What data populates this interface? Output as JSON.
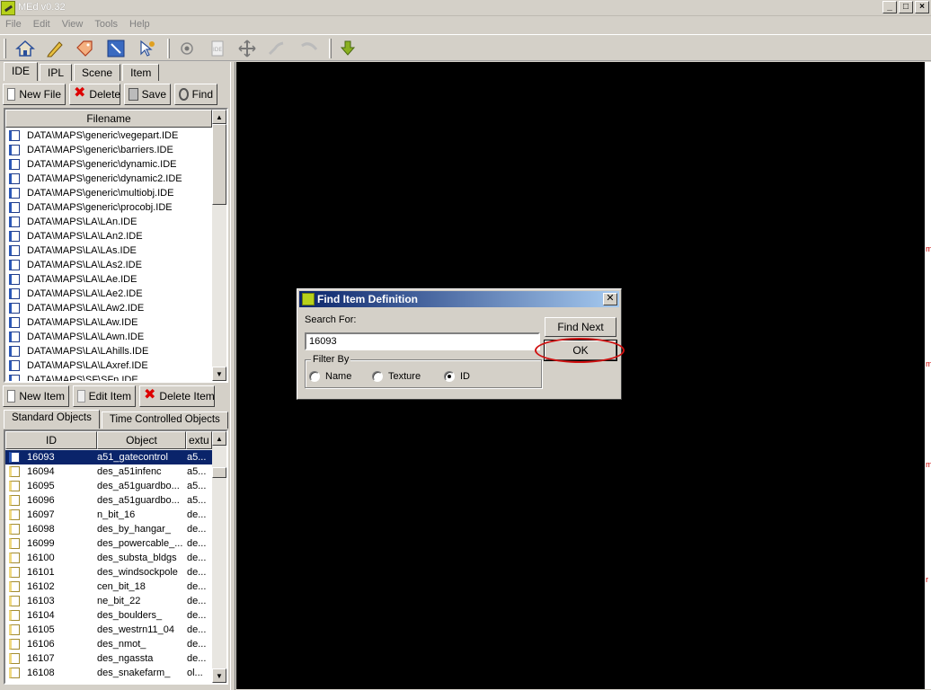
{
  "window": {
    "title": "MEd v0.32"
  },
  "menu": [
    "File",
    "Edit",
    "View",
    "Tools",
    "Help"
  ],
  "toolbar": {
    "icons": [
      "home-icon",
      "pencil-icon",
      "tag-icon",
      "select-icon",
      "pointer-icon",
      "circle-icon",
      "ide-icon",
      "move-icon",
      "rotate-icon",
      "scale-icon",
      "download-arrow-icon"
    ],
    "ide_icon_text": "IDE"
  },
  "tabs": [
    "IDE",
    "IPL",
    "Scene",
    "Item"
  ],
  "file_buttons": {
    "new": "New File",
    "delete": "Delete",
    "save": "Save",
    "find": "Find"
  },
  "file_list": {
    "header": "Filename",
    "rows": [
      "DATA\\MAPS\\generic\\vegepart.IDE",
      "DATA\\MAPS\\generic\\barriers.IDE",
      "DATA\\MAPS\\generic\\dynamic.IDE",
      "DATA\\MAPS\\generic\\dynamic2.IDE",
      "DATA\\MAPS\\generic\\multiobj.IDE",
      "DATA\\MAPS\\generic\\procobj.IDE",
      "DATA\\MAPS\\LA\\LAn.IDE",
      "DATA\\MAPS\\LA\\LAn2.IDE",
      "DATA\\MAPS\\LA\\LAs.IDE",
      "DATA\\MAPS\\LA\\LAs2.IDE",
      "DATA\\MAPS\\LA\\LAe.IDE",
      "DATA\\MAPS\\LA\\LAe2.IDE",
      "DATA\\MAPS\\LA\\LAw2.IDE",
      "DATA\\MAPS\\LA\\LAw.IDE",
      "DATA\\MAPS\\LA\\LAwn.IDE",
      "DATA\\MAPS\\LA\\LAhills.IDE",
      "DATA\\MAPS\\LA\\LAxref.IDE",
      "DATA\\MAPS\\SF\\SFn.IDE"
    ]
  },
  "item_buttons": {
    "new": "New Item",
    "edit": "Edit Item",
    "delete": "Delete Item"
  },
  "object_tabs": [
    "Standard Objects",
    "Time Controlled Objects"
  ],
  "object_list": {
    "headers": [
      "ID",
      "Object",
      "extu"
    ],
    "rows": [
      [
        "16093",
        "a51_gatecontrol",
        "a5..."
      ],
      [
        "16094",
        "des_a51infenc",
        "a5..."
      ],
      [
        "16095",
        "des_a51guardbo...",
        "a5..."
      ],
      [
        "16096",
        "des_a51guardbo...",
        "a5..."
      ],
      [
        "16097",
        "n_bit_16",
        "de..."
      ],
      [
        "16098",
        "des_by_hangar_",
        "de..."
      ],
      [
        "16099",
        "des_powercable_...",
        "de..."
      ],
      [
        "16100",
        "des_substa_bldgs",
        "de..."
      ],
      [
        "16101",
        "des_windsockpole",
        "de..."
      ],
      [
        "16102",
        "cen_bit_18",
        "de..."
      ],
      [
        "16103",
        "ne_bit_22",
        "de..."
      ],
      [
        "16104",
        "des_boulders_",
        "de..."
      ],
      [
        "16105",
        "des_westrn11_04",
        "de..."
      ],
      [
        "16106",
        "des_nmot_",
        "de..."
      ],
      [
        "16107",
        "des_ngassta",
        "de..."
      ],
      [
        "16108",
        "des_snakefarm_",
        "ol..."
      ]
    ]
  },
  "dialog": {
    "title": "Find Item Definition",
    "search_label": "Search For:",
    "search_value": "16093",
    "find_next": "Find Next",
    "ok": "OK",
    "filter_title": "Filter By",
    "filters": [
      "Name",
      "Texture",
      "ID"
    ],
    "selected_filter": "ID"
  },
  "right_marks": [
    "m",
    "m",
    "m",
    "m",
    "r"
  ]
}
